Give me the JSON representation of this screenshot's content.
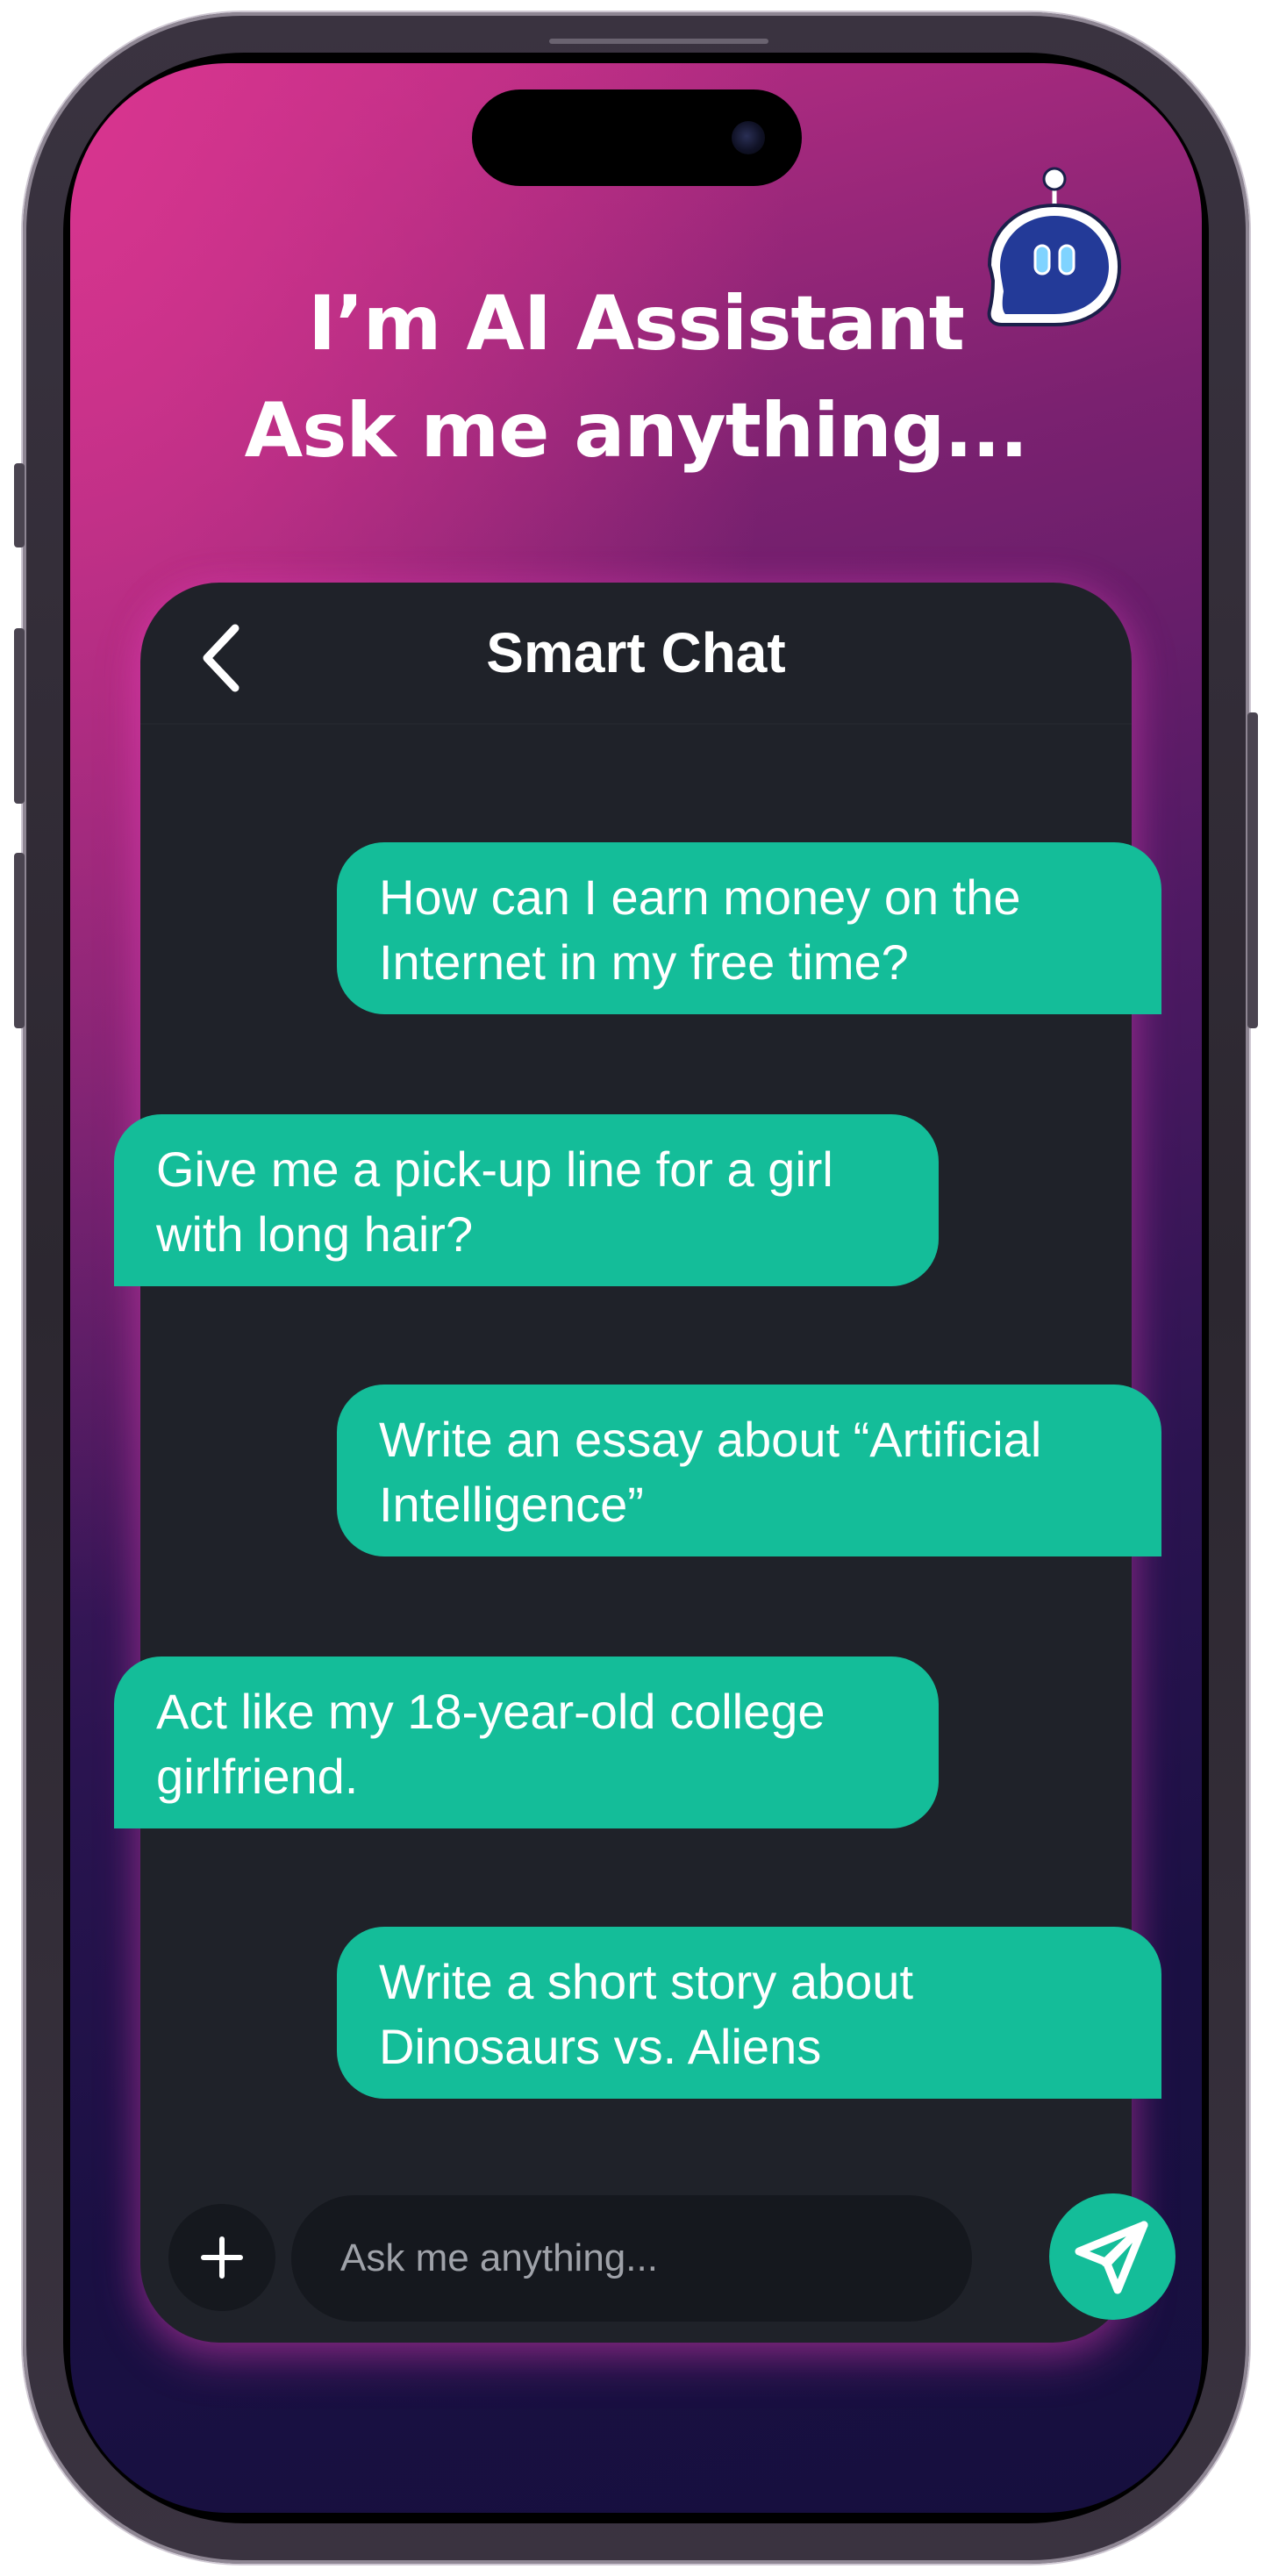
{
  "hero": {
    "line1": "I’m AI Assistant",
    "line2": "Ask me anything..."
  },
  "chat": {
    "title": "Smart Chat",
    "messages": [
      {
        "side": "right",
        "lines": [
          "How can I earn money on the",
          "Internet in my free time?"
        ]
      },
      {
        "side": "left",
        "lines": [
          "Give me a pick-up line for a girl",
          "with long hair?"
        ]
      },
      {
        "side": "right",
        "lines": [
          "Write an essay about “Artificial",
          "Intelligence”"
        ]
      },
      {
        "side": "left",
        "lines": [
          "Act like my 18-year-old college",
          "girlfriend."
        ]
      },
      {
        "side": "right",
        "lines": [
          "Write a short story about",
          "Dinosaurs vs. Aliens"
        ]
      }
    ]
  },
  "composer": {
    "placeholder": "Ask me anything...",
    "value": ""
  },
  "icons": {
    "back": "chevron-left-icon",
    "add": "plus-icon",
    "send": "paper-plane-icon",
    "logo": "robot-chat-icon"
  },
  "colors": {
    "accent": "#14bd99",
    "card": "#1f2229",
    "gradient_top": "#d8358f",
    "gradient_bottom": "#160f3e"
  }
}
